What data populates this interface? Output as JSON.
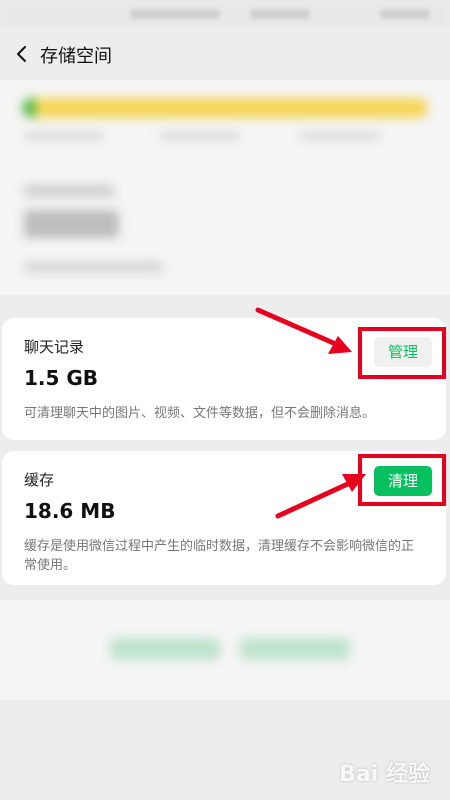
{
  "header": {
    "title": "存储空间"
  },
  "chat_records": {
    "title": "聊天记录",
    "size": "1.5 GB",
    "description": "可清理聊天中的图片、视频、文件等数据，但不会删除消息。",
    "button_label": "管理"
  },
  "cache": {
    "title": "缓存",
    "size": "18.6 MB",
    "description": "缓存是使用微信过程中产生的临时数据，清理缓存不会影响微信的正常使用。",
    "button_label": "清理"
  },
  "colors": {
    "accent": "#07c160",
    "annotation_red": "#e6001e",
    "storage_bar_yellow": "#f6d75a",
    "storage_bar_green": "#5fbb4d"
  },
  "watermark": {
    "text": "Bai 经验"
  }
}
